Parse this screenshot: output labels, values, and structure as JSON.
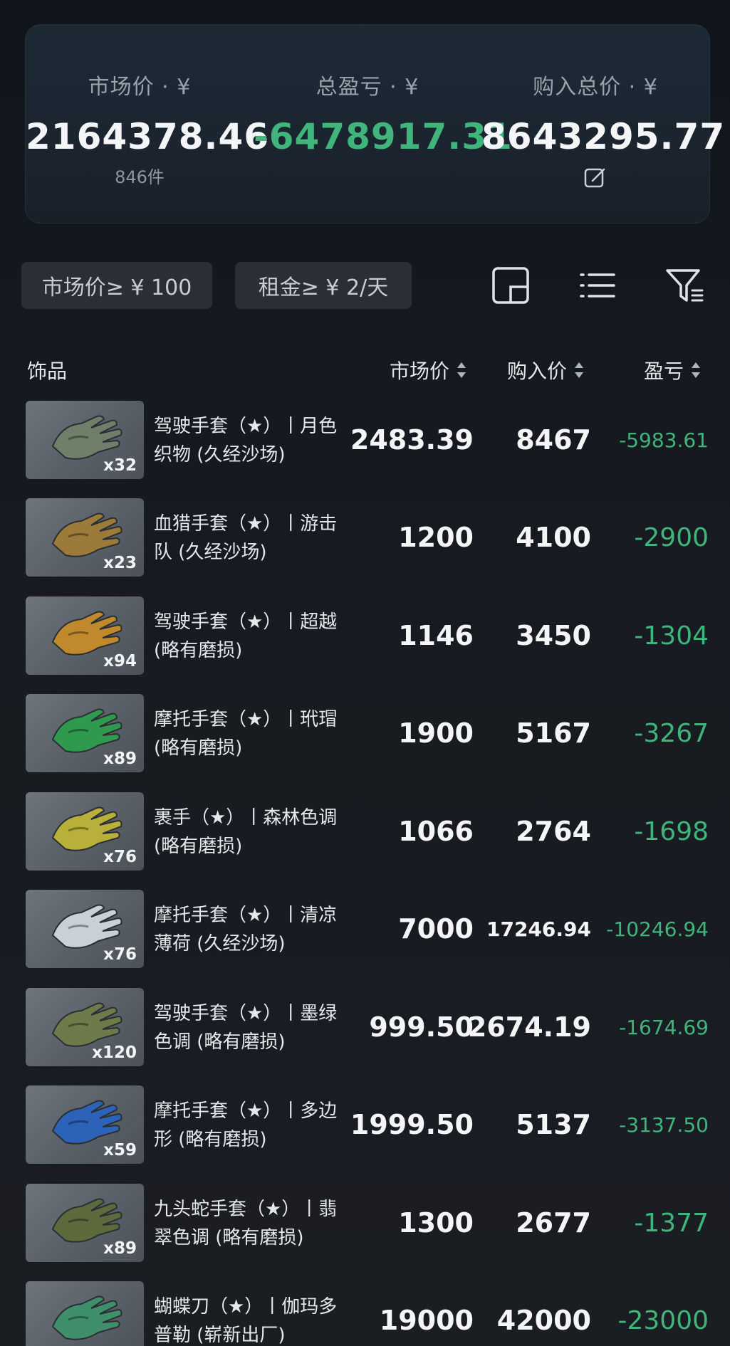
{
  "summary": {
    "market": {
      "label": "市场价 · ¥",
      "value": "2164378.46",
      "sub": "846件"
    },
    "pl": {
      "label": "总盈亏 · ¥",
      "value": "-6478917.31"
    },
    "buy": {
      "label": "购入总价 · ¥",
      "value": "8643295.77"
    }
  },
  "filters": {
    "market": "市场价≥ ¥ 100",
    "rent": "租金≥ ¥ 2/天"
  },
  "table_header": {
    "item": "饰品",
    "market": "市场价",
    "buy": "购入价",
    "pl": "盈亏"
  },
  "colors": {
    "profit_negative": "#3fb57b",
    "background": "#15191f",
    "card": "#1c2a36"
  },
  "rows": [
    {
      "name": "驾驶手套（★）丨月色织物 (久经沙场)",
      "qty": "x32",
      "market": "2483.39",
      "buy": "8467",
      "pl": "-5983.61",
      "glove": "#6f7f6a"
    },
    {
      "name": "血猎手套（★）丨游击队 (久经沙场)",
      "qty": "x23",
      "market": "1200",
      "buy": "4100",
      "pl": "-2900",
      "glove": "#9c7a3a"
    },
    {
      "name": "驾驶手套（★）丨超越 (略有磨损)",
      "qty": "x94",
      "market": "1146",
      "buy": "3450",
      "pl": "-1304",
      "glove": "#c08a2c"
    },
    {
      "name": "摩托手套（★）丨玳瑁 (略有磨损)",
      "qty": "x89",
      "market": "1900",
      "buy": "5167",
      "pl": "-3267",
      "glove": "#2f9a4e"
    },
    {
      "name": "裹手（★）丨森林色调 (略有磨损)",
      "qty": "x76",
      "market": "1066",
      "buy": "2764",
      "pl": "-1698",
      "glove": "#b8b03a"
    },
    {
      "name": "摩托手套（★）丨清凉薄荷 (久经沙场)",
      "qty": "x76",
      "market": "7000",
      "buy": "17246.94",
      "pl": "-10246.94",
      "glove": "#c9d0d6"
    },
    {
      "name": "驾驶手套（★）丨墨绿色调 (略有磨损)",
      "qty": "x120",
      "market": "999.50",
      "buy": "2674.19",
      "pl": "-1674.69",
      "glove": "#6e7a4a"
    },
    {
      "name": "摩托手套（★）丨多边形 (略有磨损)",
      "qty": "x59",
      "market": "1999.50",
      "buy": "5137",
      "pl": "-3137.50",
      "glove": "#2c63b8"
    },
    {
      "name": "九头蛇手套（★）丨翡翠色调 (略有磨损)",
      "qty": "x89",
      "market": "1300",
      "buy": "2677",
      "pl": "-1377",
      "glove": "#5c6a3c"
    },
    {
      "name": "蝴蝶刀（★）丨伽玛多普勒 (崭新出厂)",
      "qty": "",
      "market": "19000",
      "buy": "42000",
      "pl": "-23000",
      "glove": "#3f8f6a"
    }
  ]
}
